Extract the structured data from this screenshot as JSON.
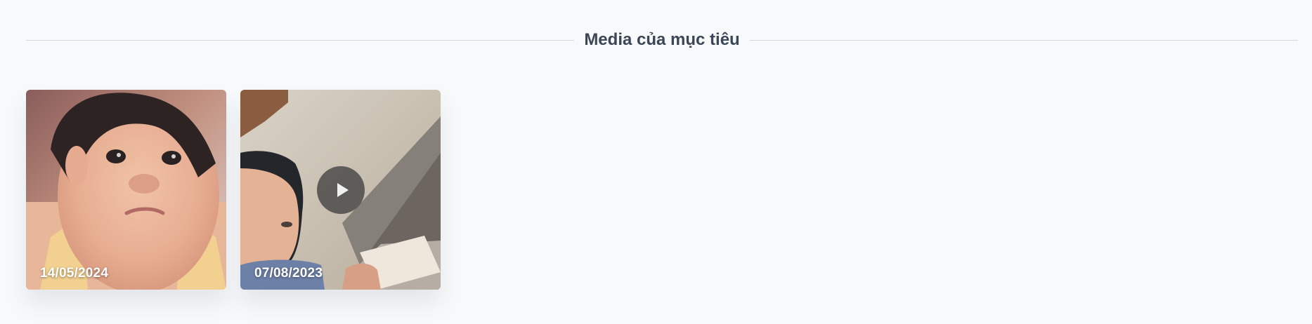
{
  "section": {
    "title": "Media của mục tiêu"
  },
  "media": [
    {
      "type": "image",
      "date": "14/05/2024",
      "thumbnail": "child-portrait-photo"
    },
    {
      "type": "video",
      "date": "07/08/2023",
      "thumbnail": "child-reading-video",
      "play_icon": "play-icon"
    }
  ],
  "colors": {
    "background": "#f8f9fb",
    "title": "#3b4656",
    "rule": "#d6d9de",
    "play_button": "#404040"
  }
}
